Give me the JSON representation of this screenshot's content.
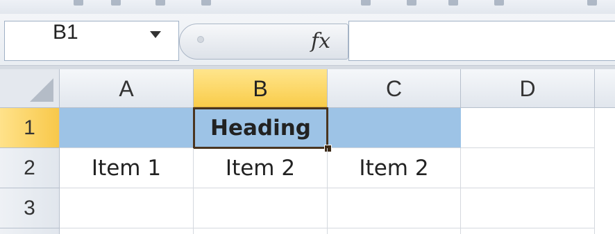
{
  "formula_bar": {
    "name_box": "B1",
    "fx_label": "fx",
    "formula_value": ""
  },
  "columns": [
    "A",
    "B",
    "C",
    "D"
  ],
  "rows": [
    "1",
    "2",
    "3"
  ],
  "cells": {
    "A1": "",
    "B1": "Heading",
    "C1": "",
    "D1": "",
    "A2": "Item 1",
    "B2": "Item 2",
    "C2": "Item 2",
    "D2": "",
    "A3": "",
    "B3": "",
    "C3": "",
    "D3": ""
  },
  "selection": {
    "active_cell": "B1",
    "selected_column": "B",
    "selected_row": "1"
  },
  "colors": {
    "row1_fill": "#9dc3e6",
    "header_highlight": "#f9cc4a",
    "active_border": "#4a3520"
  }
}
